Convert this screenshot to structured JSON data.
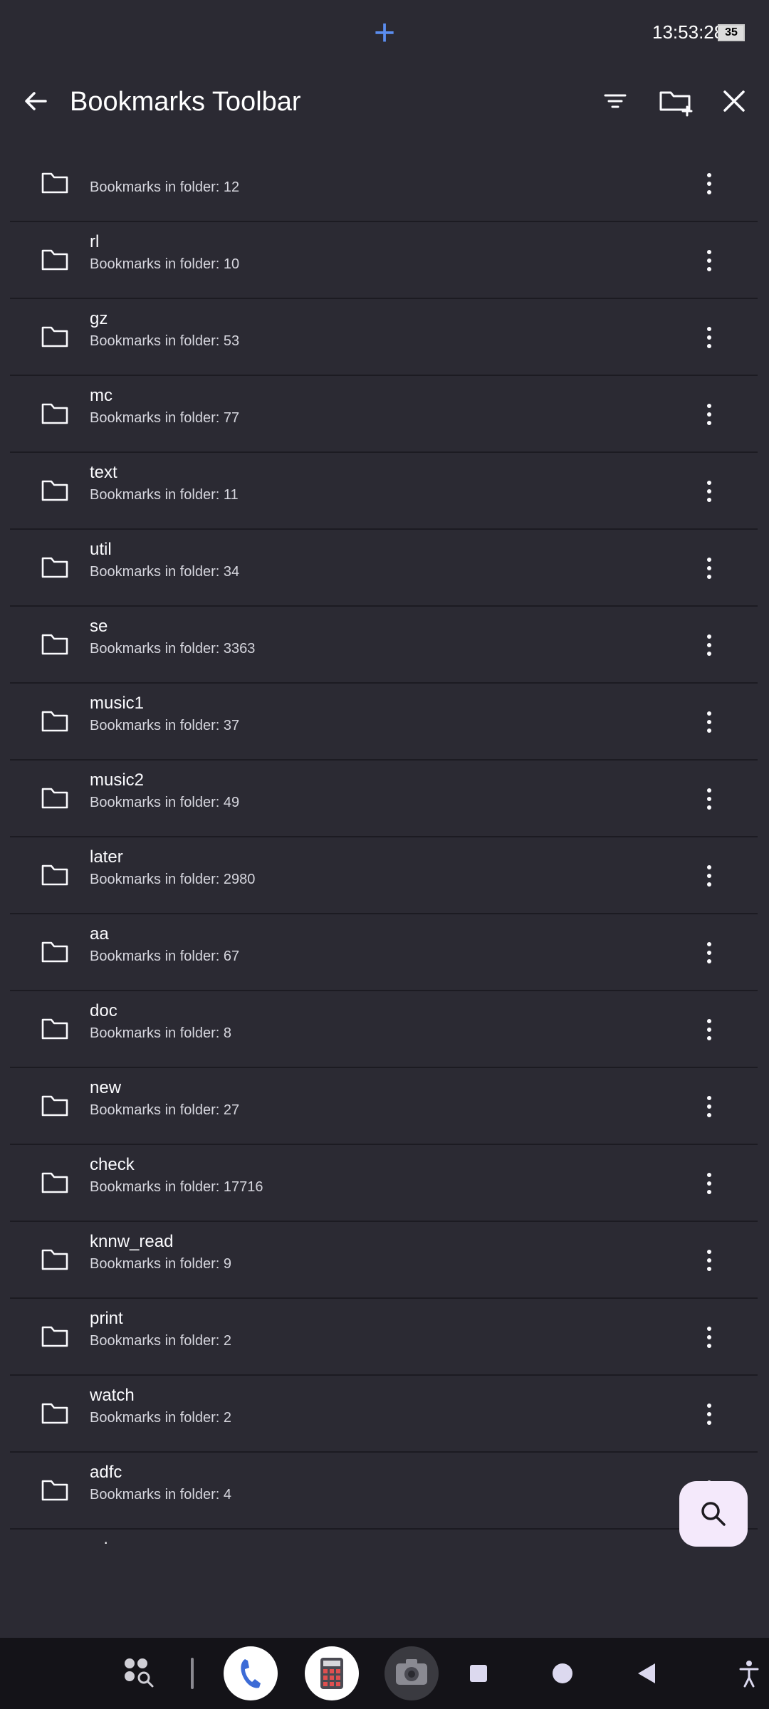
{
  "status_bar": {
    "time": "13:53:28",
    "battery": "35"
  },
  "toolbar": {
    "title": "Bookmarks Toolbar"
  },
  "folders": [
    {
      "name": "",
      "count": "Bookmarks in folder: 12"
    },
    {
      "name": "rl",
      "count": "Bookmarks in folder: 10"
    },
    {
      "name": "gz",
      "count": "Bookmarks in folder: 53"
    },
    {
      "name": "mc",
      "count": "Bookmarks in folder: 77"
    },
    {
      "name": "text",
      "count": "Bookmarks in folder: 11"
    },
    {
      "name": "util",
      "count": "Bookmarks in folder: 34"
    },
    {
      "name": "se",
      "count": "Bookmarks in folder: 3363"
    },
    {
      "name": "music1",
      "count": "Bookmarks in folder: 37"
    },
    {
      "name": "music2",
      "count": "Bookmarks in folder: 49"
    },
    {
      "name": "later",
      "count": "Bookmarks in folder: 2980"
    },
    {
      "name": "aa",
      "count": "Bookmarks in folder: 67"
    },
    {
      "name": "doc",
      "count": "Bookmarks in folder: 8"
    },
    {
      "name": "new",
      "count": "Bookmarks in folder: 27"
    },
    {
      "name": "check",
      "count": "Bookmarks in folder: 17716"
    },
    {
      "name": "knnw_read",
      "count": "Bookmarks in folder: 9"
    },
    {
      "name": "print",
      "count": "Bookmarks in folder: 2"
    },
    {
      "name": "watch",
      "count": "Bookmarks in folder: 2"
    },
    {
      "name": "adfc",
      "count": "Bookmarks in folder: 4"
    },
    {
      "name": "sd",
      "count": ""
    }
  ],
  "colors": {
    "background": "#2b2a33",
    "fab": "#f4e9fb",
    "accent": "#5b8def"
  }
}
